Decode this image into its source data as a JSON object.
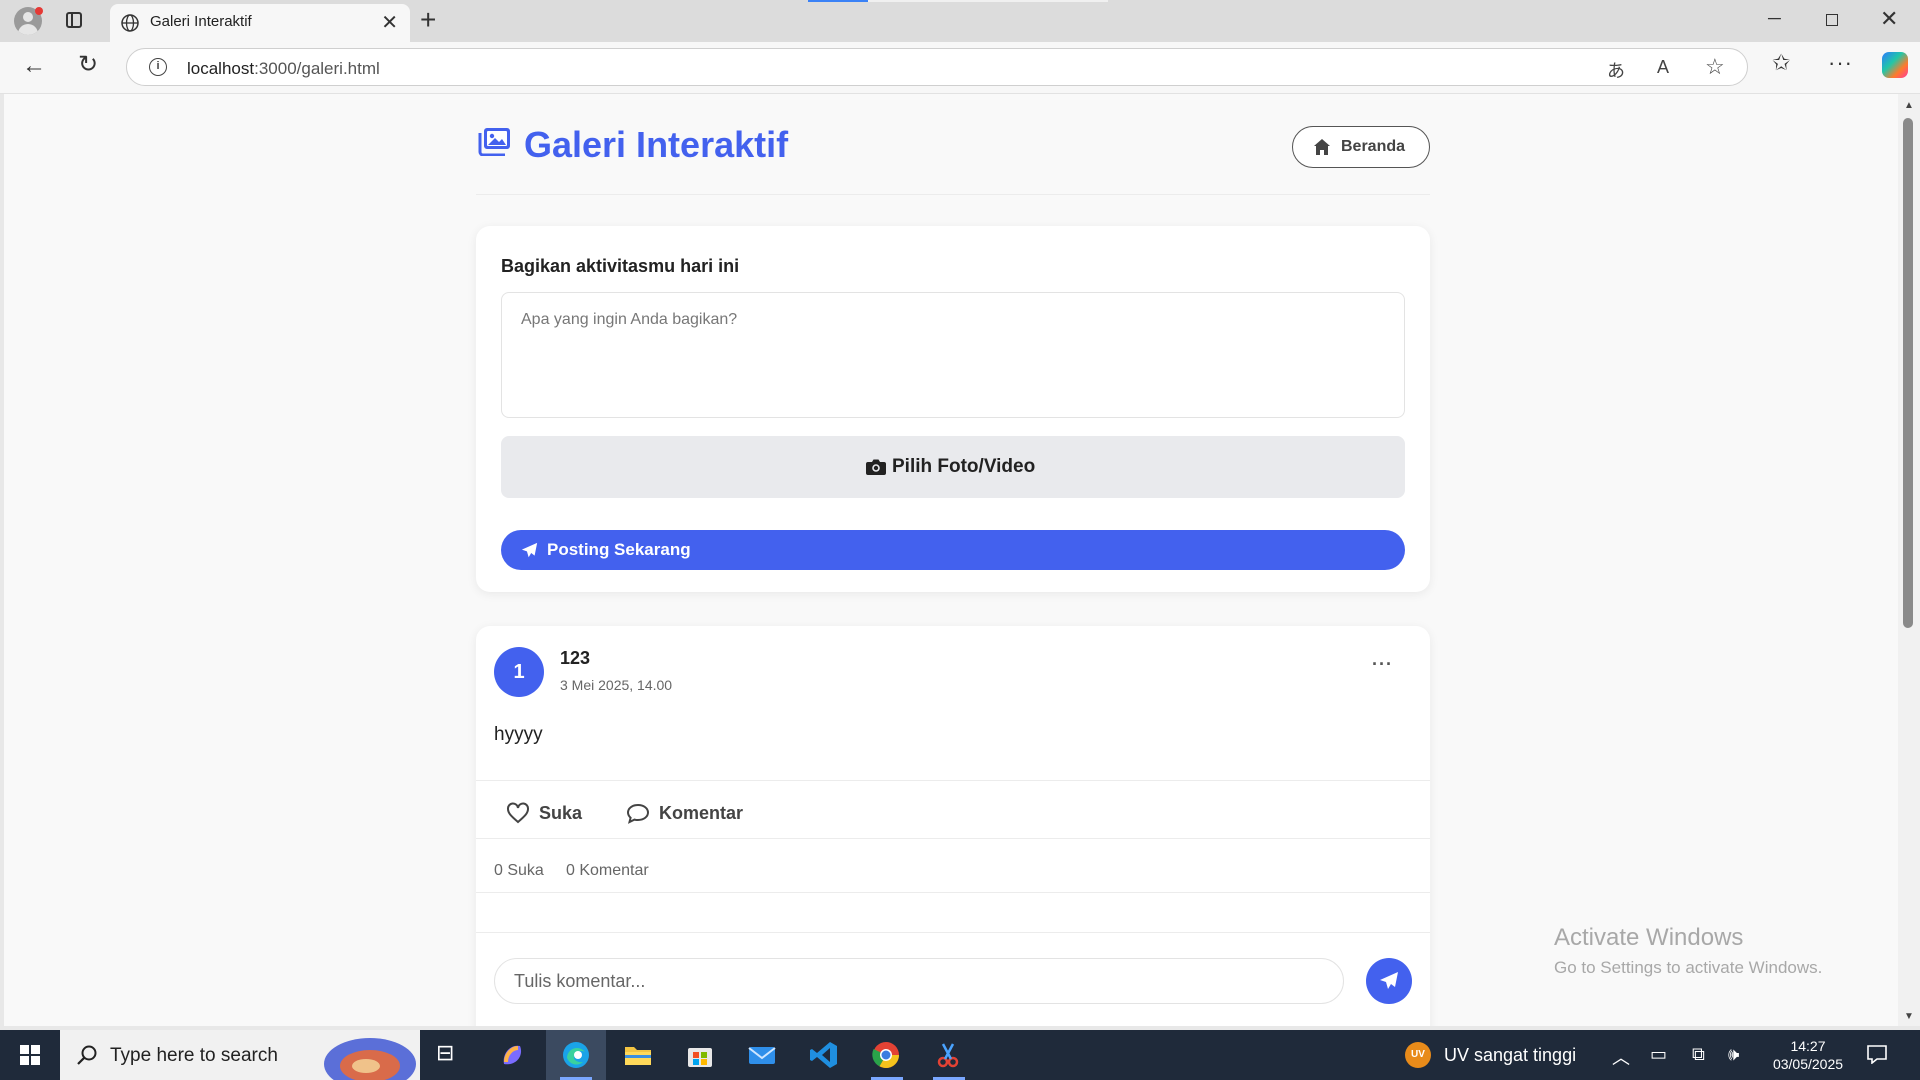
{
  "browser": {
    "tab_title": "Galeri Interaktif",
    "url_host": "localhost",
    "url_path": ":3000/galeri.html"
  },
  "page": {
    "title": "Galeri Interaktif",
    "home_label": "Beranda",
    "accent_color": "#4361ee"
  },
  "composer": {
    "heading": "Bagikan aktivitasmu hari ini",
    "placeholder": "Apa yang ingin Anda bagikan?",
    "media_label": "Pilih Foto/Video",
    "post_label": "Posting Sekarang"
  },
  "post": {
    "avatar_initial": "1",
    "author": "123",
    "time": "3 Mei 2025, 14.00",
    "content": "hyyyy",
    "like_label": "Suka",
    "comment_label": "Komentar",
    "like_count": "0 Suka",
    "comment_count": "0 Komentar",
    "comment_placeholder": "Tulis komentar..."
  },
  "watermark": {
    "title": "Activate Windows",
    "subtitle": "Go to Settings to activate Windows."
  },
  "taskbar": {
    "search_placeholder": "Type here to search",
    "uv_badge": "UV",
    "weather": "UV sangat tinggi",
    "time": "14:27",
    "date": "03/05/2025"
  }
}
